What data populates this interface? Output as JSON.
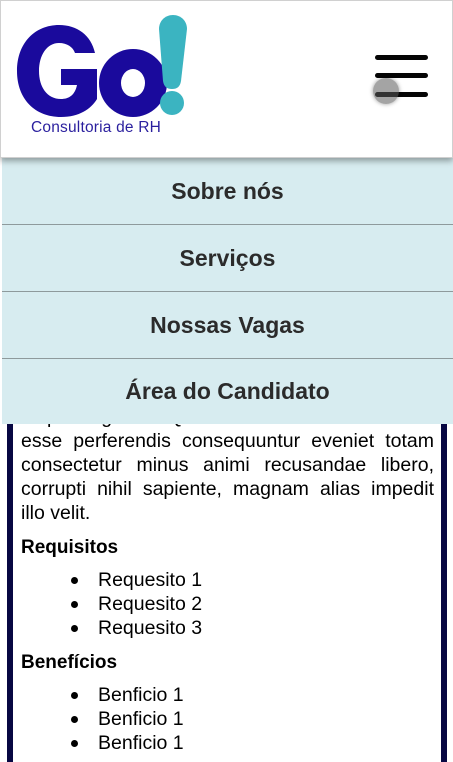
{
  "header": {
    "logo_text": "Go!",
    "logo_subtitle": "Consultoria de RH",
    "menu_icon": "hamburger-menu-icon",
    "colors": {
      "logo_blue": "#1a0a9c",
      "logo_teal": "#3bb4c1"
    }
  },
  "nav": {
    "items": [
      {
        "label": "Sobre nós"
      },
      {
        "label": "Serviços"
      },
      {
        "label": "Nossas Vagas"
      },
      {
        "label": "Área do Candidato"
      }
    ],
    "background": "#d7ecf0"
  },
  "content": {
    "description_partial": "adipisicing elit. Quasi ducimus veritatis odio esse perferendis consequuntur eveniet totam consectetur minus animi recusandae libero, corrupti nihil sapiente, magnam alias impedit illo velit.",
    "requirements_title": "Requisitos",
    "requirements": [
      "Requesito 1",
      "Requesito 2",
      "Requesito 3"
    ],
    "benefits_title": "Benefícios",
    "benefits": [
      "Benficio 1",
      "Benficio 1",
      "Benficio 1"
    ]
  }
}
